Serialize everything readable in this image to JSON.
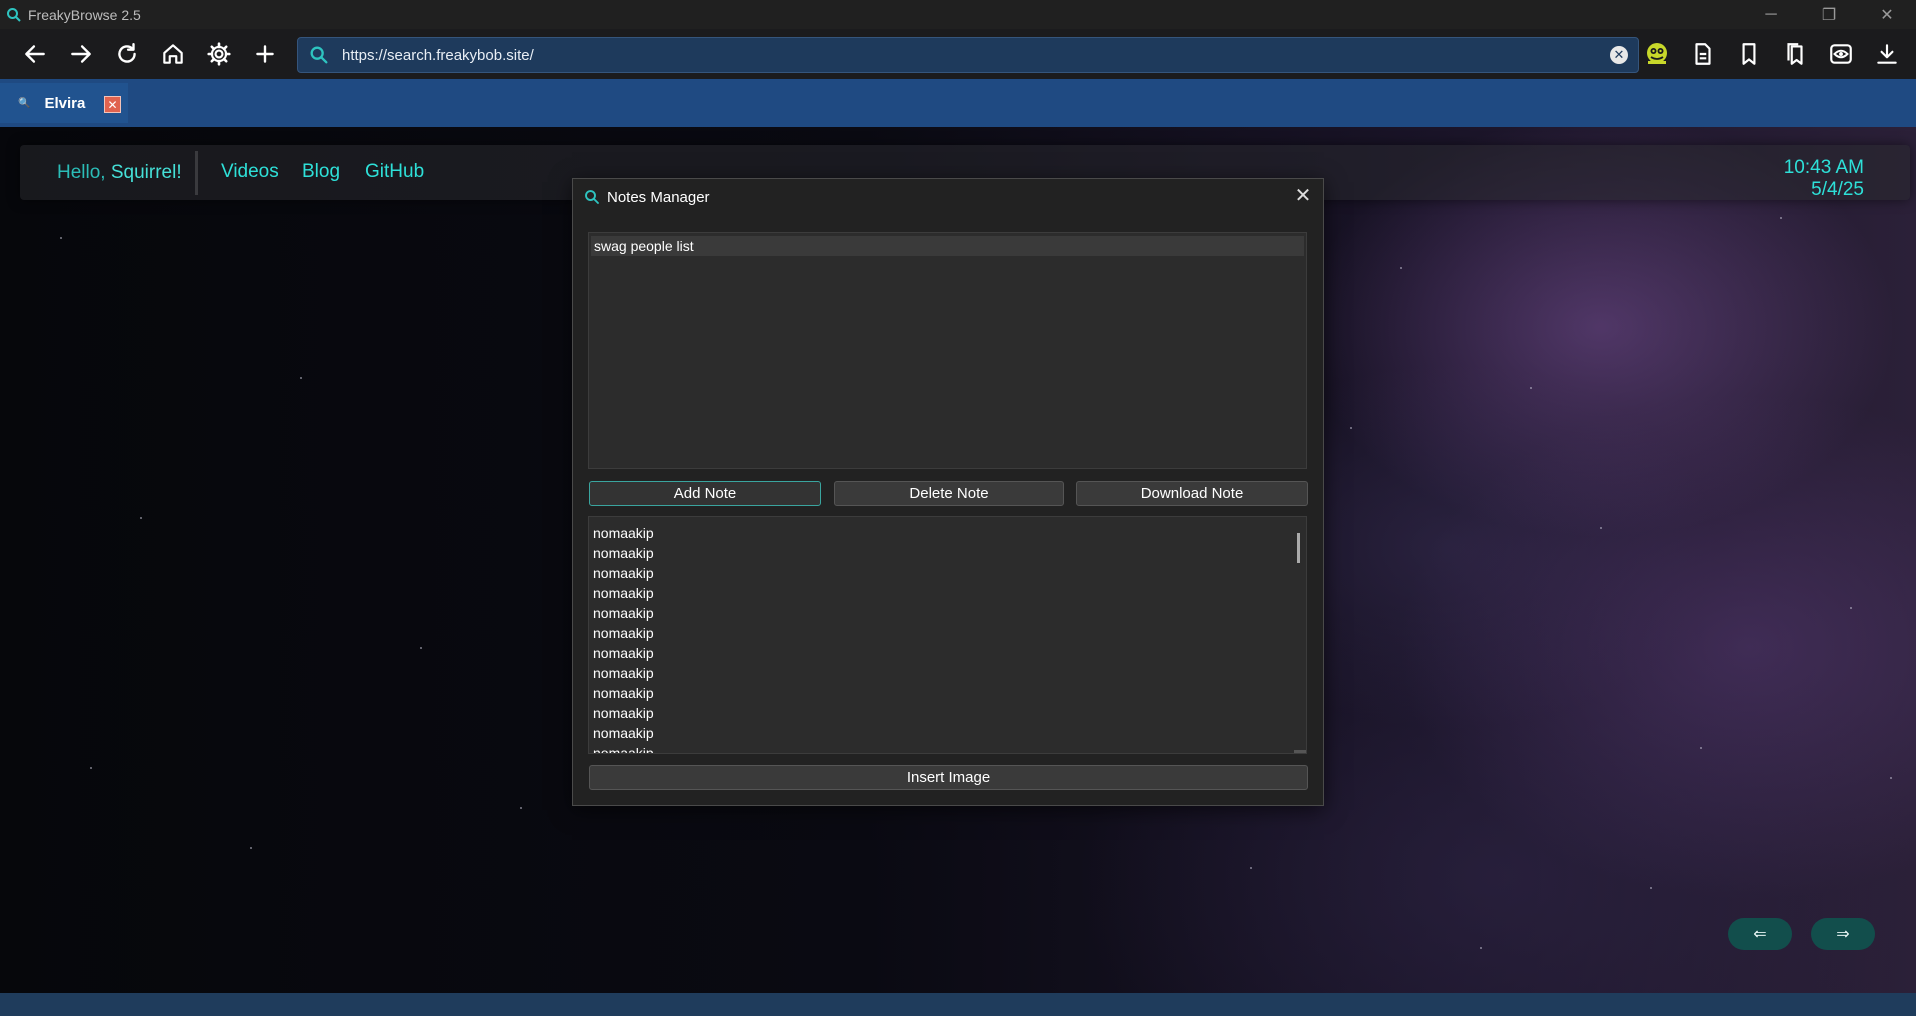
{
  "window": {
    "title": "FreakyBrowse 2.5",
    "controls": {
      "minimize": "─",
      "restore": "❐",
      "close": "✕"
    }
  },
  "toolbar": {
    "url": "https://search.freakybob.site/",
    "clear_label": "✕"
  },
  "tabs": [
    {
      "title": "Elvira",
      "close_label": "✕"
    }
  ],
  "page": {
    "greeting_prefix": "Hello,",
    "greeting_name": "Squirrel!",
    "nav_links": [
      "Videos",
      "Blog",
      "GitHub"
    ],
    "time": "10:43 AM",
    "date": "5/4/25",
    "prev_label": "⇐",
    "next_label": "⇒"
  },
  "notes_dialog": {
    "title": "Notes Manager",
    "close_label": "✕",
    "editor_text": "swag people list",
    "buttons": {
      "add": "Add Note",
      "delete": "Delete Note",
      "download": "Download Note",
      "insert_image": "Insert Image"
    },
    "notes": [
      "nomaakip",
      "nomaakip",
      "nomaakip",
      "nomaakip",
      "nomaakip",
      "nomaakip",
      "nomaakip",
      "nomaakip",
      "nomaakip",
      "nomaakip",
      "nomaakip",
      "nomaakip"
    ]
  },
  "colors": {
    "accent": "#2ee0d8",
    "urlbar": "#1e3a5c",
    "tabstrip": "#1f4a82",
    "tab_close": "#e0634f",
    "smiley": "#c8d82a"
  }
}
